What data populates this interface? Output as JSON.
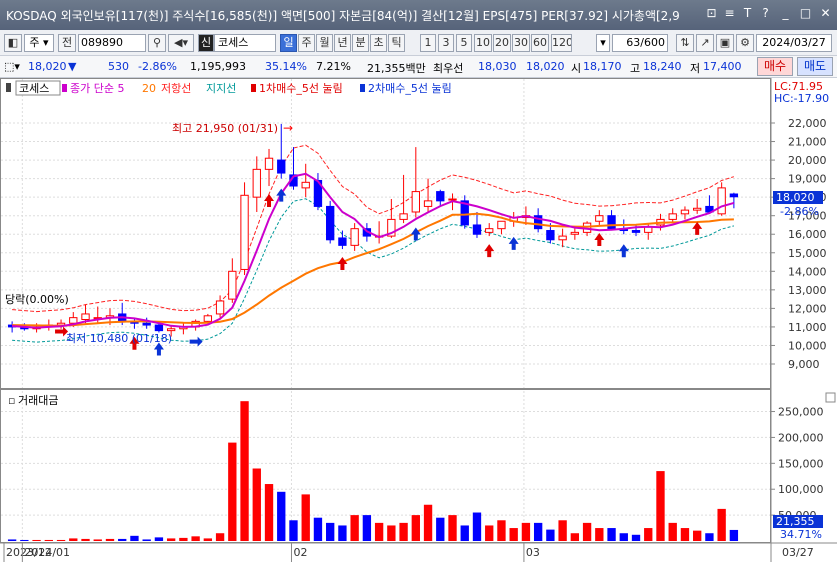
{
  "window": {
    "title": "KOSDAQ 외국인보유[117(천)] 주식수[16,585(천)] 액면[500] 자본금[84(억)] 결산[12월] EPS[475] PER[37.92] 시가총액[2,9",
    "buttons": [
      "⊡",
      "≡",
      "T",
      "?",
      "_",
      "□",
      "✕"
    ]
  },
  "toolbar": {
    "mode": "주",
    "label_jeon": "전",
    "code": "089890",
    "stock_name": "코세스",
    "periods": [
      "일",
      "주",
      "월",
      "년",
      "분",
      "초",
      "틱"
    ],
    "active_period": "일",
    "intervals": [
      "1",
      "3",
      "5",
      "10",
      "20",
      "30",
      "60",
      "120"
    ],
    "count": "63/600",
    "date": "2024/03/27"
  },
  "quote": {
    "price": "18,020",
    "change": "530",
    "change_pct": "-2.86%",
    "volume": "1,195,993",
    "vol_ratio": "35.14%",
    "turnover": "7.21%",
    "amount": "21,355백만",
    "bid_label": "최우선",
    "bid": "18,030",
    "ask": "18,020",
    "open_label": "시",
    "open": "18,170",
    "high_label": "고",
    "high": "18,240",
    "low_label": "저",
    "low": "17,400",
    "buy_button": "매수",
    "sell_button": "매도"
  },
  "price_panel": {
    "legend_stock": "코세스",
    "legend_close": "종가 단순 5",
    "legend_ma20": "20",
    "legend_resistance": "저항선",
    "legend_support": "지지선",
    "legend_band1": "1차매수_5선 눌림",
    "legend_band2": "2차매수_5선 눌림",
    "lc": "LC:71.95",
    "hc": "HC:-17.90",
    "high_annotation": "최고 21,950 (01/31)",
    "low_annotation": "최저 10,480 (01/18)",
    "drop_annotation": "당락(0.00%)",
    "current_price_tag": "18,020",
    "current_pct_tag": "-2.86%",
    "yaxis": [
      "22,000",
      "21,000",
      "20,000",
      "19,000",
      "18,000",
      "17,000",
      "16,000",
      "15,000",
      "14,000",
      "13,000",
      "12,000",
      "11,000",
      "10,000",
      "9,000"
    ]
  },
  "volume_panel": {
    "title": "거래대금",
    "yaxis": [
      "250,000",
      "200,000",
      "150,000",
      "100,000",
      "50,000"
    ],
    "current_tag": "21,355",
    "current_pct_tag": "34.71%"
  },
  "xaxis": {
    "labels": [
      "2023/12",
      "2024/01",
      "02",
      "03"
    ],
    "right_label": "03/27"
  },
  "colors": {
    "up": "#ff0000",
    "down": "#0000ff",
    "ma5": "#cc00cc",
    "ma20": "#ff7700",
    "resistance": "#ff2222",
    "support": "#009999"
  },
  "chart_data": {
    "type": "candlestick",
    "dates": [
      "12/28",
      "01/02",
      "01/03",
      "01/04",
      "01/05",
      "01/08",
      "01/09",
      "01/10",
      "01/11",
      "01/12",
      "01/15",
      "01/16",
      "01/17",
      "01/18",
      "01/19",
      "01/22",
      "01/23",
      "01/24",
      "01/25",
      "01/26",
      "01/29",
      "01/30",
      "01/31",
      "02/01",
      "02/02",
      "02/05",
      "02/06",
      "02/07",
      "02/08",
      "02/13",
      "02/14",
      "02/15",
      "02/16",
      "02/19",
      "02/20",
      "02/21",
      "02/22",
      "02/23",
      "02/26",
      "02/27",
      "02/28",
      "02/29",
      "03/04",
      "03/05",
      "03/06",
      "03/07",
      "03/08",
      "03/11",
      "03/12",
      "03/13",
      "03/14",
      "03/15",
      "03/18",
      "03/19",
      "03/20",
      "03/21",
      "03/22",
      "03/25",
      "03/26",
      "03/27"
    ],
    "open": [
      11100,
      11000,
      10900,
      11000,
      11100,
      11200,
      11400,
      11500,
      11500,
      11700,
      11300,
      11200,
      11100,
      10800,
      10900,
      11000,
      11300,
      11700,
      12500,
      14100,
      18000,
      19500,
      20000,
      19200,
      18500,
      18900,
      17500,
      15800,
      15400,
      16300,
      15900,
      15900,
      16800,
      17200,
      17500,
      18300,
      17900,
      17800,
      16500,
      16100,
      16300,
      16700,
      16900,
      17000,
      16200,
      15700,
      16000,
      16100,
      16700,
      17000,
      16300,
      16200,
      16100,
      16500,
      16800,
      17100,
      17300,
      17500,
      17100,
      18170
    ],
    "high": [
      11300,
      11200,
      11200,
      11400,
      11400,
      11800,
      12200,
      12100,
      12000,
      12300,
      11500,
      11500,
      11300,
      11100,
      11200,
      11400,
      11700,
      12700,
      14700,
      18800,
      20200,
      20600,
      21950,
      20700,
      19800,
      19300,
      17800,
      16200,
      16600,
      16600,
      16700,
      17900,
      19200,
      20700,
      19000,
      18400,
      18200,
      18100,
      17200,
      16600,
      16700,
      17200,
      17500,
      17400,
      16600,
      16300,
      16400,
      16700,
      17300,
      17300,
      16800,
      16500,
      16600,
      17100,
      17400,
      17500,
      17900,
      18100,
      18800,
      18240
    ],
    "low": [
      10700,
      10800,
      10700,
      10800,
      10900,
      11000,
      11200,
      11200,
      11100,
      11100,
      10900,
      10900,
      10700,
      10480,
      10600,
      10800,
      11100,
      11500,
      12300,
      13800,
      17200,
      18600,
      19000,
      18400,
      18000,
      17300,
      15500,
      15200,
      15100,
      15600,
      15500,
      15800,
      16600,
      16900,
      17200,
      17500,
      17300,
      16300,
      15800,
      15900,
      16000,
      16400,
      16500,
      16100,
      15500,
      15300,
      15700,
      15900,
      16500,
      16200,
      16000,
      15900,
      15700,
      16200,
      16600,
      16800,
      17100,
      17100,
      17000,
      17400
    ],
    "close": [
      11000,
      10900,
      11000,
      11100,
      11200,
      11500,
      11700,
      11500,
      11600,
      11300,
      11200,
      11100,
      10800,
      10900,
      11000,
      11300,
      11600,
      12400,
      14000,
      18100,
      19500,
      20100,
      19300,
      18600,
      18800,
      17500,
      15700,
      15400,
      16300,
      15900,
      15900,
      16800,
      17100,
      18300,
      17800,
      17800,
      17900,
      16500,
      16000,
      16300,
      16700,
      16900,
      17000,
      16300,
      15700,
      15900,
      16100,
      16600,
      17000,
      16300,
      16200,
      16100,
      16400,
      16800,
      17100,
      17300,
      17400,
      17200,
      18500,
      18020
    ],
    "value": [
      3000,
      2000,
      2000,
      2000,
      2000,
      5000,
      4000,
      3000,
      4000,
      4000,
      10000,
      3000,
      7000,
      5000,
      6000,
      9000,
      5000,
      15000,
      190000,
      270000,
      140000,
      110000,
      95000,
      40000,
      90000,
      45000,
      35000,
      30000,
      50000,
      50000,
      35000,
      30000,
      35000,
      50000,
      70000,
      45000,
      50000,
      30000,
      55000,
      30000,
      40000,
      25000,
      35000,
      35000,
      22000,
      40000,
      15000,
      35000,
      25000,
      25000,
      15000,
      12000,
      25000,
      135000,
      35000,
      25000,
      20000,
      15000,
      62000,
      21355
    ],
    "ma5": [
      11050,
      11000,
      10950,
      11000,
      11040,
      11140,
      11300,
      11400,
      11500,
      11520,
      11460,
      11340,
      11200,
      11060,
      11000,
      11020,
      11120,
      11440,
      12040,
      13480,
      15120,
      16820,
      18200,
      19120,
      19260,
      18860,
      18000,
      17200,
      16820,
      16160,
      15840,
      16060,
      16400,
      16820,
      17180,
      17520,
      17780,
      17660,
      17500,
      17300,
      17080,
      16880,
      16980,
      16840,
      16720,
      16520,
      16360,
      16300,
      16220,
      16240,
      16300,
      16380,
      16400,
      16380,
      16520,
      16720,
      16940,
      17140,
      17500,
      17690
    ],
    "ma20": [
      11100,
      11090,
      11080,
      11070,
      11060,
      11100,
      11150,
      11200,
      11250,
      11280,
      11300,
      11300,
      11280,
      11250,
      11220,
      11210,
      11230,
      11280,
      11430,
      11770,
      12210,
      12690,
      13120,
      13490,
      13870,
      14170,
      14370,
      14500,
      14760,
      14990,
      15190,
      15460,
      15750,
      16100,
      16440,
      16730,
      17050,
      17060,
      17110,
      17030,
      16890,
      16700,
      16600,
      16530,
      16450,
      16420,
      16410,
      16400,
      16450,
      16480,
      16500,
      16510,
      16560,
      16620,
      16640,
      16650,
      16660,
      16690,
      16780,
      16800
    ],
    "ylim": [
      8500,
      22800
    ],
    "vol_ylim": [
      0,
      280000
    ]
  }
}
